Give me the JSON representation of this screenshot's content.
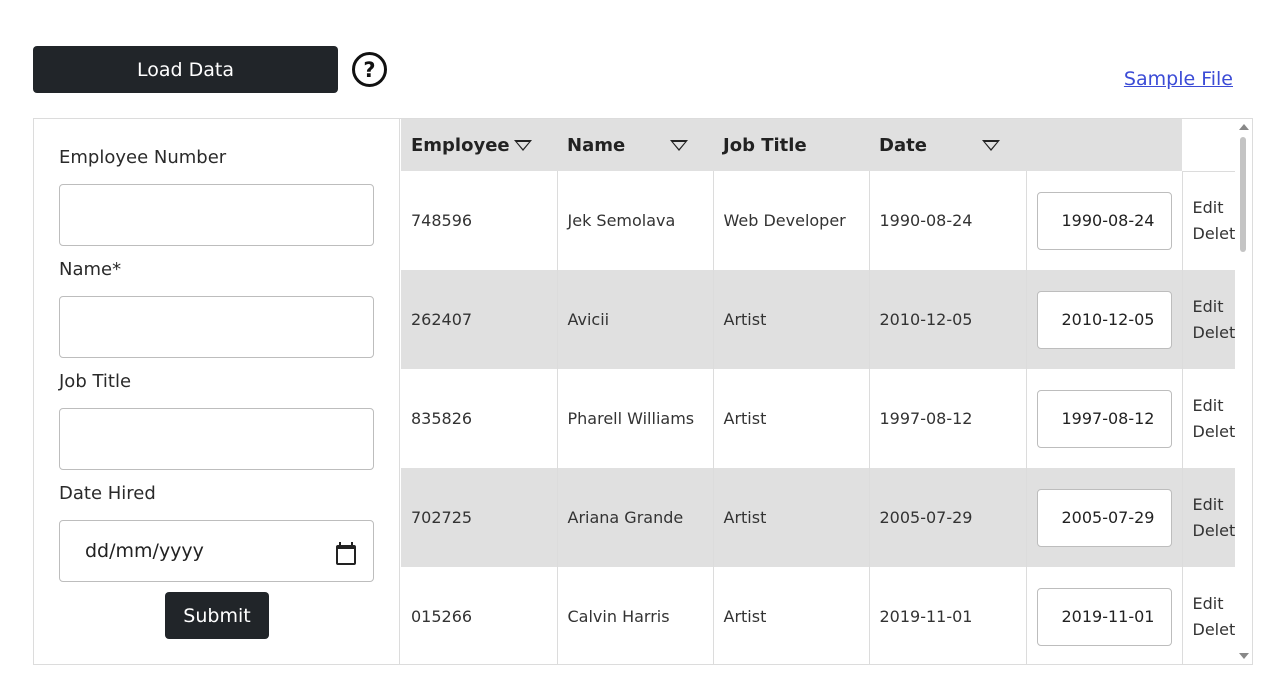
{
  "toolbar": {
    "load_label": "Load Data",
    "help_symbol": "?",
    "sample_link": "Sample File"
  },
  "form": {
    "employee_number_label": "Employee Number",
    "name_label": "Name*",
    "job_title_label": "Job Title",
    "date_hired_label": "Date Hired",
    "date_placeholder": "dd/mm/yyyy",
    "submit_label": "Submit"
  },
  "table": {
    "headers": [
      "Employee",
      "Name",
      "Job Title",
      "Date",
      ""
    ],
    "sortable_columns": [
      "Employee",
      "Name",
      "Date"
    ],
    "rows": [
      {
        "employee": "748596",
        "name": "Jek Semolava",
        "job_title": "Web Developer",
        "date": "1990-08-24",
        "date_input": "1990-08-24"
      },
      {
        "employee": "262407",
        "name": "Avicii",
        "job_title": "Artist",
        "date": "2010-12-05",
        "date_input": "2010-12-05"
      },
      {
        "employee": "835826",
        "name": "Pharell Williams",
        "job_title": "Artist",
        "date": "1997-08-12",
        "date_input": "1997-08-12"
      },
      {
        "employee": "702725",
        "name": "Ariana Grande",
        "job_title": "Artist",
        "date": "2005-07-29",
        "date_input": "2005-07-29"
      },
      {
        "employee": "015266",
        "name": "Calvin Harris",
        "job_title": "Artist",
        "date": "2019-11-01",
        "date_input": "2019-11-01"
      }
    ],
    "edit_label": "Edit",
    "delete_label": "Delete"
  }
}
